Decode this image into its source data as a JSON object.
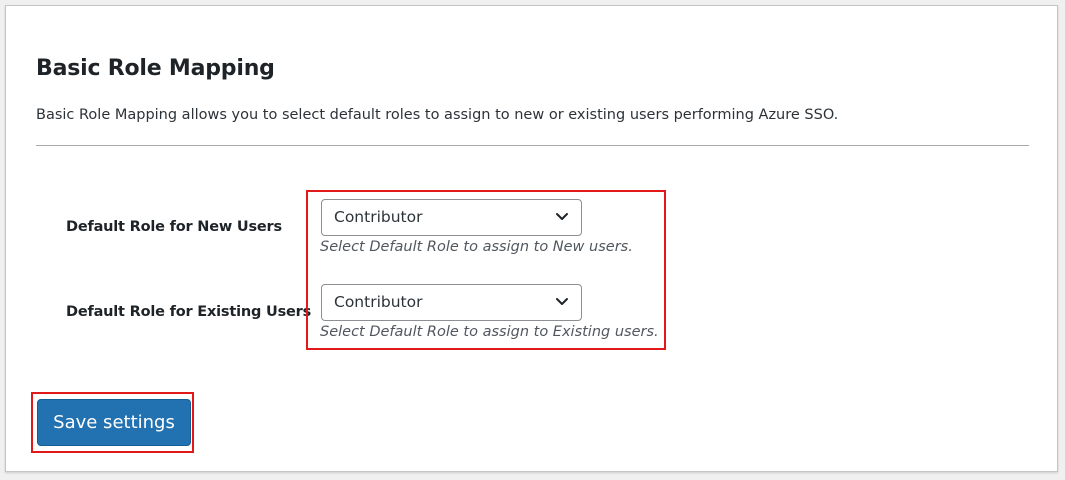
{
  "section": {
    "title": "Basic Role Mapping",
    "description": "Basic Role Mapping allows you to select default roles to assign to new or existing users performing Azure SSO."
  },
  "fields": {
    "new_users": {
      "label": "Default Role for New Users",
      "selected": "Contributor",
      "hint": "Select Default Role to assign to New users."
    },
    "existing_users": {
      "label": "Default Role for Existing Users",
      "selected": "Contributor",
      "hint": "Select Default Role to assign to Existing users."
    }
  },
  "actions": {
    "save_label": "Save settings"
  },
  "icons": {
    "dropdown": "chevron-down-icon"
  },
  "colors": {
    "primary": "#2271b1",
    "highlight": "#e11919",
    "text": "#1d2327"
  }
}
